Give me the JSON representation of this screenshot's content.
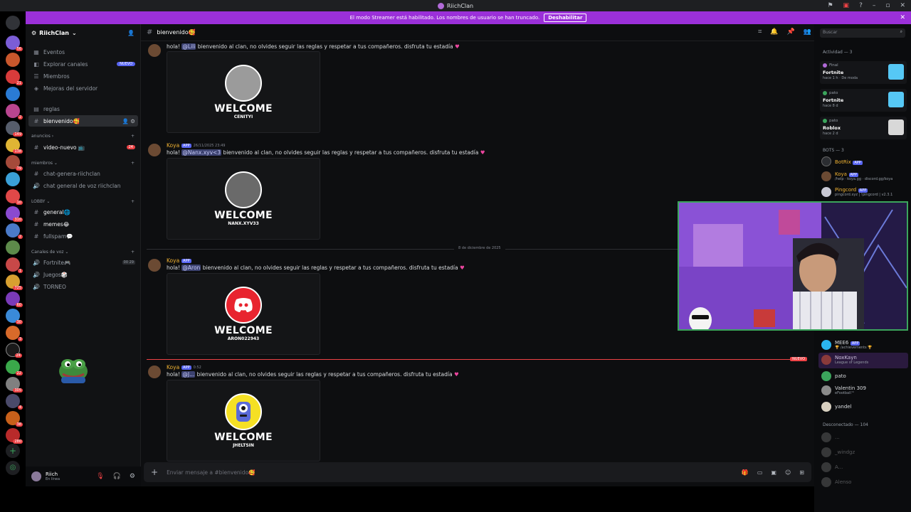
{
  "window": {
    "title": "RiichClan"
  },
  "banner": {
    "text": "El modo Streamer está habilitado. Los nombres de usuario se han truncado.",
    "button": "Deshabilitar"
  },
  "server": {
    "name": "RiichClan"
  },
  "sidebar": {
    "top_items": [
      {
        "label": "Eventos",
        "icon": "calendar-icon"
      },
      {
        "label": "Explorar canales",
        "icon": "explore-icon",
        "badge": "NUEVO"
      },
      {
        "label": "Miembros",
        "icon": "members-icon"
      },
      {
        "label": "Mejoras del servidor",
        "icon": "boost-icon"
      }
    ],
    "channels": {
      "reglas": "reglas",
      "bienvenido": "bienvenido🥰",
      "cat_anuncios": "anuncios",
      "video_nuevo": "video-nuevo 📺",
      "video_badge": "24",
      "cat_miembros": "miembros",
      "chat_genera": "chat-genera-riichclan",
      "chat_voz": "chat general de voz riichclan",
      "cat_lobby": "LOBBY",
      "general": "general🌐",
      "memes": "memes😂",
      "fullspam": "fullspam💬",
      "cat_voz": "Canales de voz",
      "fortnite": "Fortnite🎮",
      "fortnite_count": "00 29",
      "juegos": "Juegos🎲",
      "torneo": "TORNEO"
    }
  },
  "user": {
    "name": "Riich",
    "status": "En línea"
  },
  "channel_header": {
    "name": "bienvenido🥰"
  },
  "messages": [
    {
      "pre": "hola! ",
      "mention": "@Lili",
      "post": " bienvenido al clan, no olvides seguir las reglas y respetar a tus compañeros. disfruta tu estadía",
      "card_name": "CENITYI"
    },
    {
      "author": "Koya",
      "app": "APP",
      "time": "26/11/2025 23:49",
      "pre": "hola! ",
      "mention": "@Nanx.xyv<3",
      "post": " bienvenido al clan, no olvides seguir las reglas y respetar a tus compañeros. disfruta tu estadía",
      "card_name": "NANX.XYV33"
    },
    {
      "author": "Koya",
      "app": "APP",
      "time": "",
      "pre": "hola! ",
      "mention": "@Aron",
      "post": " bienvenido al clan, no olvides seguir las reglas y respetar a tus compañeros. disfruta tu estadía",
      "card_name": "ARON022943"
    },
    {
      "author": "Koya",
      "app": "APP",
      "time": "0:52",
      "pre": "hola! ",
      "mention": "@J...",
      "post": " bienvenido al clan, no olvides seguir las reglas y respetar a tus compañeros. disfruta tu estadía",
      "card_name": "JHELTSIN"
    }
  ],
  "welcome_text": "WELCOME",
  "date_divider": "8 de diciembre de 2025",
  "new_label": "NUEVO",
  "composer": {
    "placeholder": "Enviar mensaje a #bienvenido🥰"
  },
  "rightbar": {
    "search": "Buscar",
    "activity_header": "Actividad — 3",
    "activities": [
      {
        "user": "Final",
        "game": "Fortnite",
        "time": "hace 1 h · De moda",
        "color": "#56c8f5"
      },
      {
        "user": "pato",
        "game": "Fortnite",
        "time": "hace 8 d",
        "color": "#56c8f5"
      },
      {
        "user": "pato",
        "game": "Roblox",
        "time": "hace 2 d",
        "color": "#d8d8d8"
      }
    ],
    "bots_header": "BOTS — 3",
    "bots": [
      {
        "name": "BotRix",
        "app": "APP",
        "sub": ""
      },
      {
        "name": "Koya",
        "app": "APP",
        "sub": "/help · koya.gg · discord.gg/koya"
      },
      {
        "name": "Pingcord",
        "app": "APP",
        "sub": "pingcord.xyz | !pingcord | v2.3.1"
      }
    ],
    "members": [
      {
        "name": "MEE6",
        "app": "APP",
        "sub": "🏆 /achievements 🏆",
        "color": "#2bb5f0"
      },
      {
        "name": "NoxKayn",
        "sub": "League of Legends",
        "color": "#cfc3e0"
      },
      {
        "name": "pato",
        "sub": "",
        "color": "#dbdee1"
      },
      {
        "name": "Valentin 309",
        "sub": "eFootball™",
        "color": "#dbdee1"
      },
      {
        "name": "yandel",
        "sub": "",
        "color": "#dbdee1"
      }
    ],
    "offline_header": "Desconectado — 104",
    "offline": [
      "...",
      "_windgz",
      "A...",
      "Alenso"
    ]
  }
}
